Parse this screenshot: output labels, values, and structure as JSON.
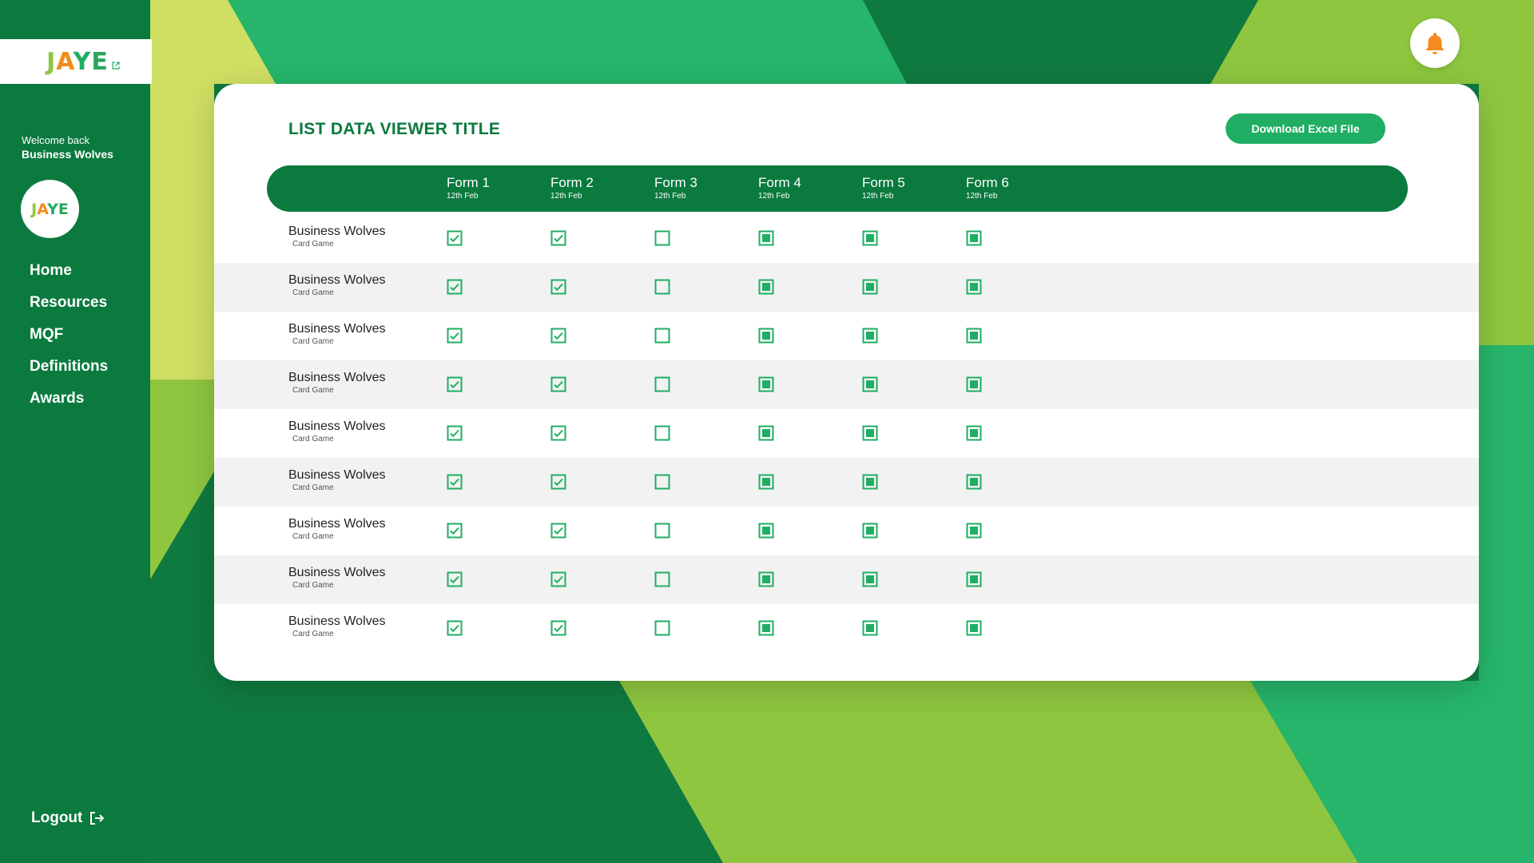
{
  "brand": {
    "logo_letters": [
      "J",
      "A",
      "Y",
      "E"
    ],
    "avatar_letters": [
      "J",
      "A",
      "Y",
      "E"
    ]
  },
  "colors": {
    "primary_dark": "#0b7a3e",
    "accent": "#1fae63",
    "bell": "#f58a1f"
  },
  "sidebar": {
    "welcome_line1": "Welcome back",
    "welcome_line2": "Business Wolves",
    "nav": [
      {
        "label": "Home"
      },
      {
        "label": "Resources"
      },
      {
        "label": "MQF"
      },
      {
        "label": "Definitions"
      },
      {
        "label": "Awards"
      }
    ],
    "logout_label": "Logout"
  },
  "main": {
    "title": "LIST DATA VIEWER TITLE",
    "download_label": "Download Excel File",
    "columns": [
      {
        "label": "Form 1",
        "date": "12th Feb"
      },
      {
        "label": "Form 2",
        "date": "12th Feb"
      },
      {
        "label": "Form 3",
        "date": "12th Feb"
      },
      {
        "label": "Form 4",
        "date": "12th Feb"
      },
      {
        "label": "Form 5",
        "date": "12th Feb"
      },
      {
        "label": "Form 6",
        "date": "12th Feb"
      }
    ],
    "rows": [
      {
        "name": "Business Wolves",
        "subtitle": "Card Game",
        "states": [
          "checked",
          "checked",
          "empty",
          "filled",
          "filled",
          "filled"
        ]
      },
      {
        "name": "Business Wolves",
        "subtitle": "Card Game",
        "states": [
          "checked",
          "checked",
          "empty",
          "filled",
          "filled",
          "filled"
        ]
      },
      {
        "name": "Business Wolves",
        "subtitle": "Card Game",
        "states": [
          "checked",
          "checked",
          "empty",
          "filled",
          "filled",
          "filled"
        ]
      },
      {
        "name": "Business Wolves",
        "subtitle": "Card Game",
        "states": [
          "checked",
          "checked",
          "empty",
          "filled",
          "filled",
          "filled"
        ]
      },
      {
        "name": "Business Wolves",
        "subtitle": "Card Game",
        "states": [
          "checked",
          "checked",
          "empty",
          "filled",
          "filled",
          "filled"
        ]
      },
      {
        "name": "Business Wolves",
        "subtitle": "Card Game",
        "states": [
          "checked",
          "checked",
          "empty",
          "filled",
          "filled",
          "filled"
        ]
      },
      {
        "name": "Business Wolves",
        "subtitle": "Card Game",
        "states": [
          "checked",
          "checked",
          "empty",
          "filled",
          "filled",
          "filled"
        ]
      },
      {
        "name": "Business Wolves",
        "subtitle": "Card Game",
        "states": [
          "checked",
          "checked",
          "empty",
          "filled",
          "filled",
          "filled"
        ]
      },
      {
        "name": "Business Wolves",
        "subtitle": "Card Game",
        "states": [
          "checked",
          "checked",
          "empty",
          "filled",
          "filled",
          "filled"
        ]
      }
    ]
  }
}
